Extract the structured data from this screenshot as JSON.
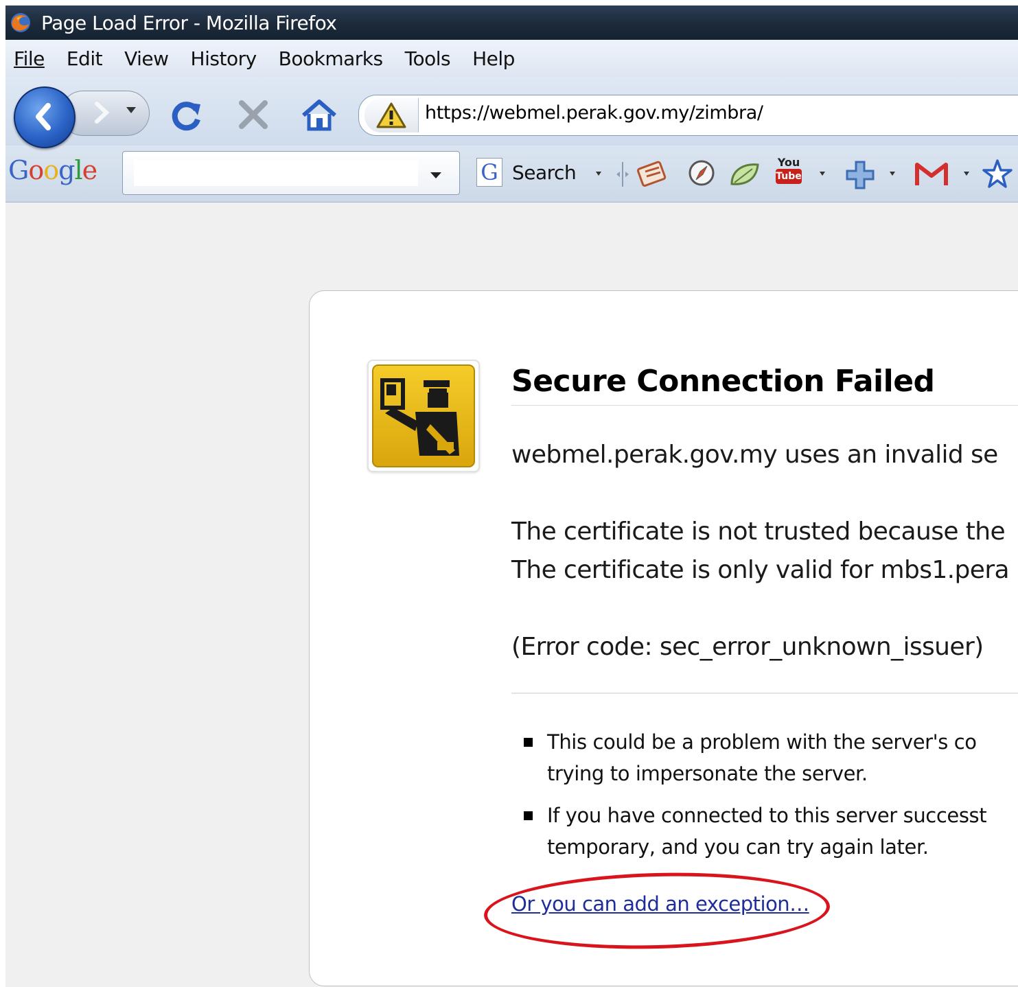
{
  "window": {
    "title": "Page Load Error - Mozilla Firefox",
    "app_icon": "firefox-icon"
  },
  "menubar": {
    "items": [
      {
        "label": "File"
      },
      {
        "label": "Edit"
      },
      {
        "label": "View"
      },
      {
        "label": "History"
      },
      {
        "label": "Bookmarks"
      },
      {
        "label": "Tools"
      },
      {
        "label": "Help"
      }
    ]
  },
  "navbar": {
    "back_icon": "back-arrow-icon",
    "forward_icon": "forward-arrow-icon",
    "reload_icon": "reload-icon",
    "stop_icon": "stop-icon",
    "home_icon": "home-icon",
    "site_identity_icon": "warning-icon",
    "url": "https://webmel.perak.gov.my/zimbra/"
  },
  "google_toolbar": {
    "logo": {
      "G": "G",
      "o1": "o",
      "o2": "o",
      "g": "g",
      "l": "l",
      "e": "e"
    },
    "search_placeholder": "",
    "search_value": "",
    "search_button_icon_glyph": "G",
    "search_button_label": "Search",
    "icons": [
      "news-icon",
      "compass-icon",
      "bookmark-leaf-icon",
      "youtube-icon",
      "add-plus-icon",
      "gmail-icon",
      "star-icon"
    ],
    "youtube_text_top": "You",
    "youtube_text_bottom": "Tube"
  },
  "error_page": {
    "icon": "security-officer-icon",
    "title": "Secure Connection Failed",
    "line1": "webmel.perak.gov.my uses an invalid se",
    "line2a": "The certificate is not trusted because the",
    "line2b": "The certificate is only valid for mbs1.pera",
    "error_code": "(Error code: sec_error_unknown_issuer)",
    "bullets": [
      {
        "line1": "This could be a problem with the server's co",
        "line2": "trying to impersonate the server."
      },
      {
        "line1": "If you have connected to this server successt",
        "line2": "temporary, and you can try again later."
      }
    ],
    "exception_link": "Or you can add an exception…"
  },
  "colors": {
    "annotation": "#d9141c",
    "link": "#1f2d9b",
    "icon_gold": "#e8b818"
  }
}
